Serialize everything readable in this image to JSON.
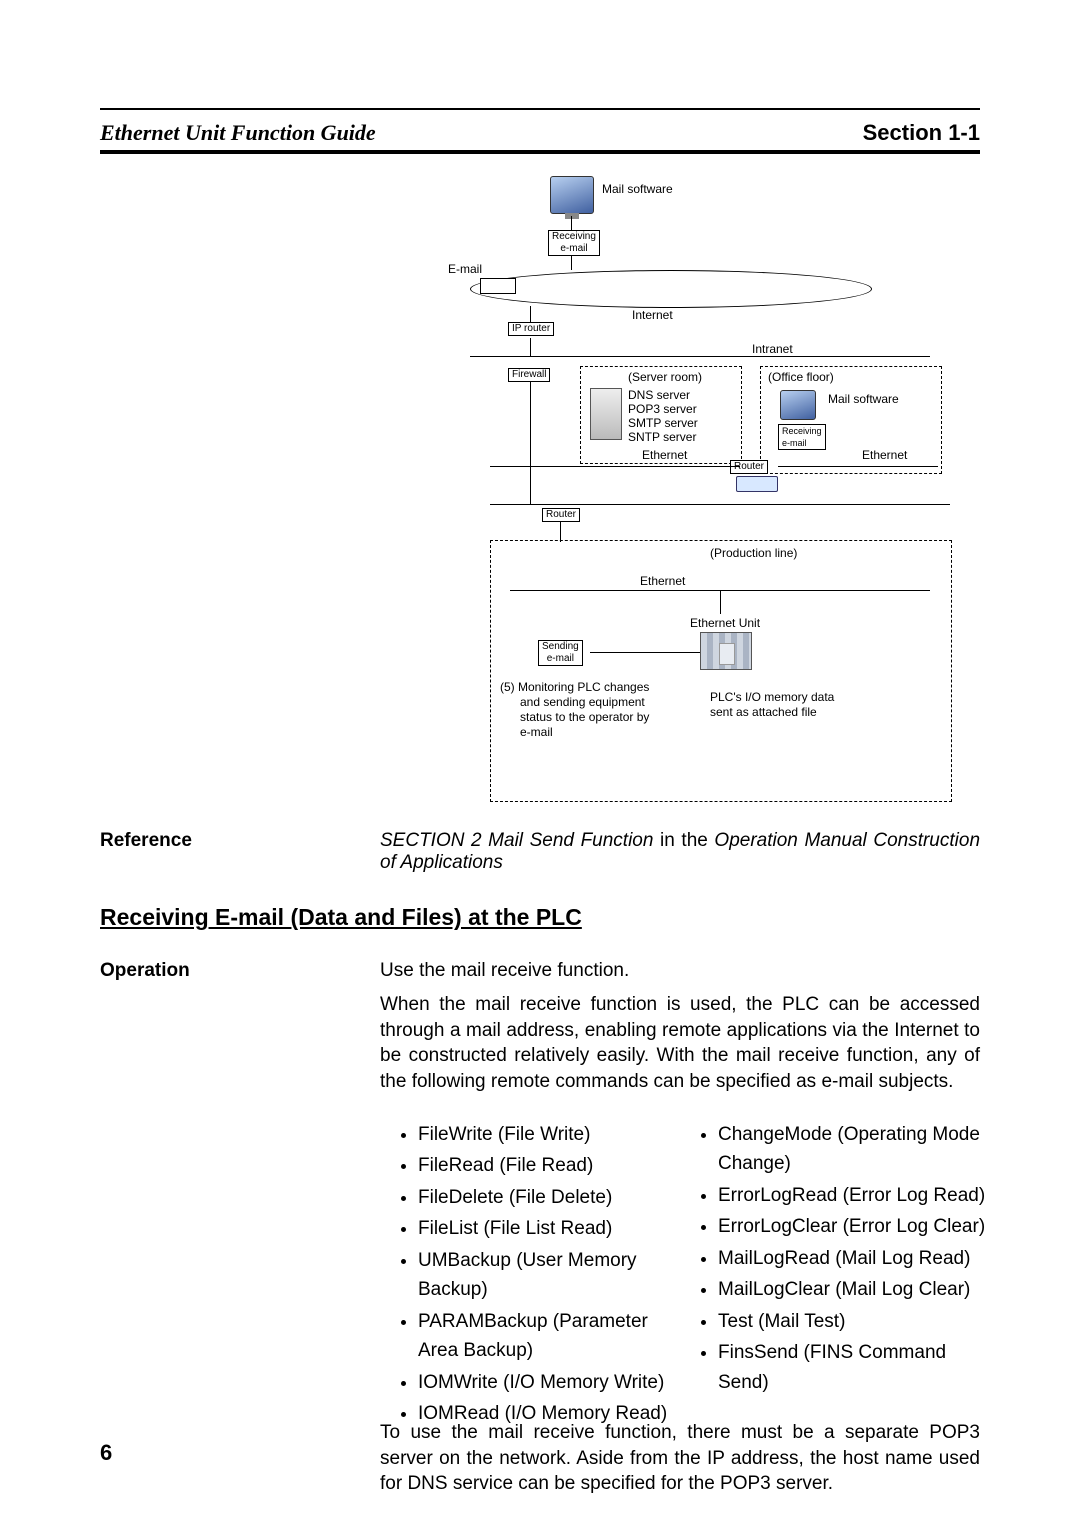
{
  "header": {
    "left": "Ethernet Unit Function Guide",
    "right": "Section 1-1"
  },
  "diagram": {
    "mail_software": "Mail software",
    "receiving_email": "Receiving\ne-mail",
    "email": "E-mail",
    "internet": "Internet",
    "ip_router": "IP router",
    "firewall": "Firewall",
    "intranet": "Intranet",
    "server_room": "(Server room)",
    "office_floor": "(Office floor)",
    "dns_server": "DNS server",
    "pop3_server": "POP3 server",
    "smtp_server": "SMTP server",
    "sntp_server": "SNTP server",
    "ethernet": "Ethernet",
    "router": "Router",
    "production_line": "(Production line)",
    "ethernet_unit": "Ethernet Unit",
    "sending_email": "Sending\ne-mail",
    "note5": "(5) Monitoring PLC changes\n      and sending equipment\n      status to the operator by\n      e-mail",
    "plc_io": "PLC's I/O memory data\nsent as attached file"
  },
  "reference": {
    "label": "Reference",
    "italic_lead": "SECTION 2 Mail Send Function",
    "mid": " in the ",
    "italic_trail": "Operation Manual Construction of Applications"
  },
  "subhead": "Receiving E-mail (Data and Files) at the PLC",
  "operation": {
    "label": "Operation",
    "line": "Use the mail receive function.",
    "para": "When the mail receive function is used, the PLC can be accessed through a mail address, enabling remote applications via the Internet to be constructed relatively easily. With the mail receive function, any of the following remote commands can be specified as e-mail subjects."
  },
  "commands_left": [
    "FileWrite (File Write)",
    "FileRead (File Read)",
    "FileDelete (File Delete)",
    "FileList (File List Read)",
    "UMBackup (User Memory Backup)",
    "PARAMBackup (Parameter Area Backup)",
    "IOMWrite (I/O Memory Write)",
    "IOMRead (I/O Memory Read)"
  ],
  "commands_right": [
    "ChangeMode (Operating Mode Change)",
    "ErrorLogRead (Error Log Read)",
    "ErrorLogClear (Error Log Clear)",
    "MailLogRead (Mail Log Read)",
    "MailLogClear (Mail Log Clear)",
    "Test (Mail Test)",
    "FinsSend (FINS Command Send)"
  ],
  "tail": "To use the mail receive function, there must be a separate POP3 server on the network. Aside from the IP address, the host name used for DNS service can be specified for the POP3 server.",
  "page_number": "6"
}
